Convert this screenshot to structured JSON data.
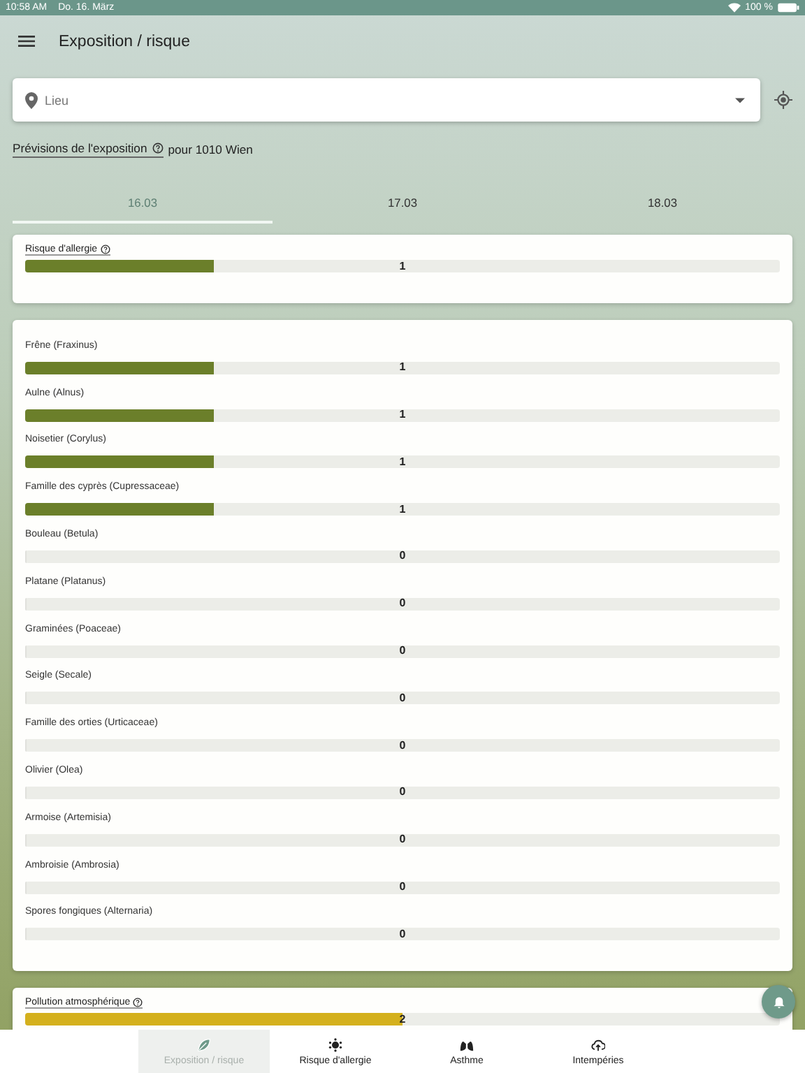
{
  "status_bar": {
    "time": "10:58 AM",
    "date": "Do. 16. März",
    "battery": "100 %"
  },
  "header": {
    "title": "Exposition / risque"
  },
  "location_field": {
    "placeholder": "Lieu"
  },
  "forecast": {
    "link": "Prévisions de l'exposition",
    "suffix": "pour 1010 Wien"
  },
  "tabs": [
    {
      "label": "16.03",
      "selected": true
    },
    {
      "label": "17.03",
      "selected": false
    },
    {
      "label": "18.03",
      "selected": false
    }
  ],
  "cards": [
    {
      "title": "Risque d'allergie",
      "help": true,
      "rows": [
        {
          "value": "1",
          "level": 0.25,
          "color": "#6b7f2a"
        }
      ]
    },
    {
      "rows": [
        {
          "label": "Frêne (Fraxinus)",
          "value": "1",
          "level": 0.25,
          "color": "#6b7f2a"
        },
        {
          "label": "Aulne (Alnus)",
          "value": "1",
          "level": 0.25,
          "color": "#6b7f2a"
        },
        {
          "label": "Noisetier (Corylus)",
          "value": "1",
          "level": 0.25,
          "color": "#6b7f2a"
        },
        {
          "label": "Famille des cyprès (Cupressaceae)",
          "value": "1",
          "level": 0.25,
          "color": "#6b7f2a"
        },
        {
          "label": "Bouleau (Betula)",
          "value": "0",
          "level": 0
        },
        {
          "label": "Platane (Platanus)",
          "value": "0",
          "level": 0
        },
        {
          "label": "Graminées (Poaceae)",
          "value": "0",
          "level": 0
        },
        {
          "label": "Seigle (Secale)",
          "value": "0",
          "level": 0
        },
        {
          "label": "Famille des orties (Urticaceae)",
          "value": "0",
          "level": 0
        },
        {
          "label": "Olivier (Olea)",
          "value": "0",
          "level": 0
        },
        {
          "label": "Armoise (Artemisia)",
          "value": "0",
          "level": 0
        },
        {
          "label": "Ambroisie (Ambrosia)",
          "value": "0",
          "level": 0
        },
        {
          "label": "Spores fongiques (Alternaria)",
          "value": "0",
          "level": 0
        }
      ]
    },
    {
      "title": "Pollution atmosphérique",
      "help": true,
      "rows": [
        {
          "value": "2",
          "level": 0.5,
          "color": "#d4b01c"
        }
      ]
    }
  ],
  "bottom_nav": [
    {
      "label": "Exposition / risque",
      "selected": true
    },
    {
      "label": "Risque d'allergie",
      "selected": false
    },
    {
      "label": "Asthme",
      "selected": false
    },
    {
      "label": "Intempéries",
      "selected": false
    }
  ]
}
